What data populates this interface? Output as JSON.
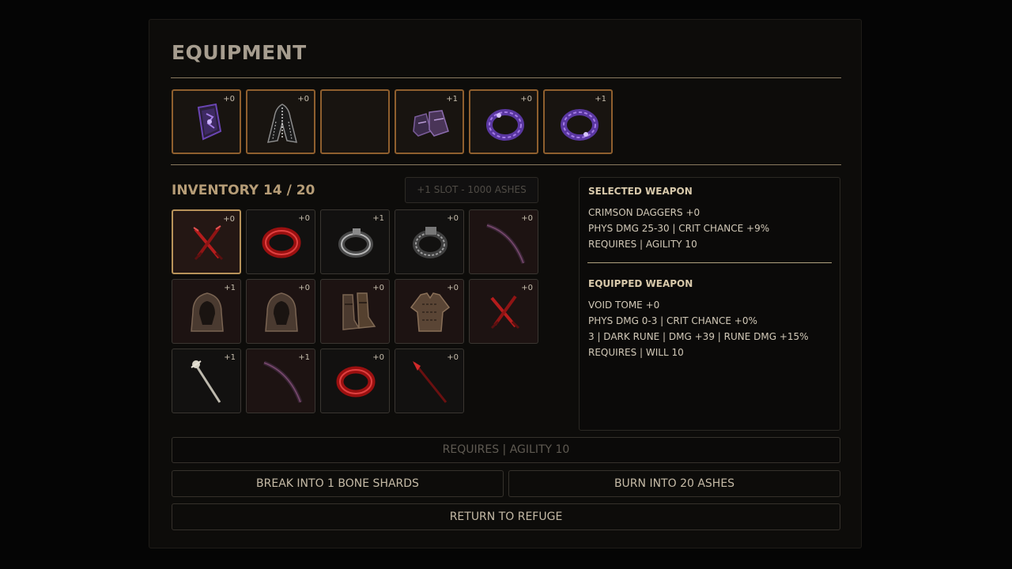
{
  "header": {
    "title": "EQUIPMENT"
  },
  "equipped_slots": [
    {
      "icon": "void-tome-icon",
      "level": "+0"
    },
    {
      "icon": "dark-robe-icon",
      "level": "+0"
    },
    {
      "icon": "",
      "level": ""
    },
    {
      "icon": "void-boots-icon",
      "level": "+1"
    },
    {
      "icon": "void-ring-icon",
      "level": "+0"
    },
    {
      "icon": "void-ring-icon",
      "level": "+1"
    }
  ],
  "inventory": {
    "title": "INVENTORY 14 / 20",
    "buy_slot_label": "+1 SLOT - 1000 ASHES",
    "items": [
      {
        "icon": "crimson-daggers-icon",
        "level": "+0"
      },
      {
        "icon": "crimson-ring-icon",
        "level": "+0"
      },
      {
        "icon": "iron-ring-icon",
        "level": "+1"
      },
      {
        "icon": "iron-ring-icon",
        "level": "+0"
      },
      {
        "icon": "dark-bow-icon",
        "level": "+0"
      },
      {
        "icon": "leather-hood-icon",
        "level": "+1"
      },
      {
        "icon": "leather-hood-icon",
        "level": "+0"
      },
      {
        "icon": "leather-boots-icon",
        "level": "+0"
      },
      {
        "icon": "leather-armor-icon",
        "level": "+0"
      },
      {
        "icon": "crimson-daggers-icon",
        "level": "+0"
      },
      {
        "icon": "bone-staff-icon",
        "level": "+1"
      },
      {
        "icon": "dark-bow-icon",
        "level": "+1"
      },
      {
        "icon": "crimson-ring-icon",
        "level": "+0"
      },
      {
        "icon": "crimson-spear-icon",
        "level": "+0"
      }
    ]
  },
  "selected_weapon": {
    "heading": "SELECTED WEAPON",
    "name": "CRIMSON DAGGERS +0",
    "stats": "PHYS DMG 25-30 | CRIT CHANCE +9%",
    "requires": "REQUIRES | AGILITY 10"
  },
  "equipped_weapon": {
    "heading": "EQUIPPED WEAPON",
    "name": "VOID TOME +0",
    "stats": "PHYS DMG 0-3 | CRIT CHANCE +0%",
    "runes": "3 | DARK RUNE | DMG +39 | RUNE DMG +15%",
    "requires": "REQUIRES | WILL 10"
  },
  "actions": {
    "requirement_banner": "REQUIRES | AGILITY 10",
    "break_label": "BREAK INTO 1 BONE SHARDS",
    "burn_label": "BURN INTO 20 ASHES",
    "return_label": "RETURN TO REFUGE"
  },
  "colors": {
    "slot_border": "#8f5f2e",
    "selected_border": "#b8935a",
    "heading_gold": "#b69d77"
  }
}
